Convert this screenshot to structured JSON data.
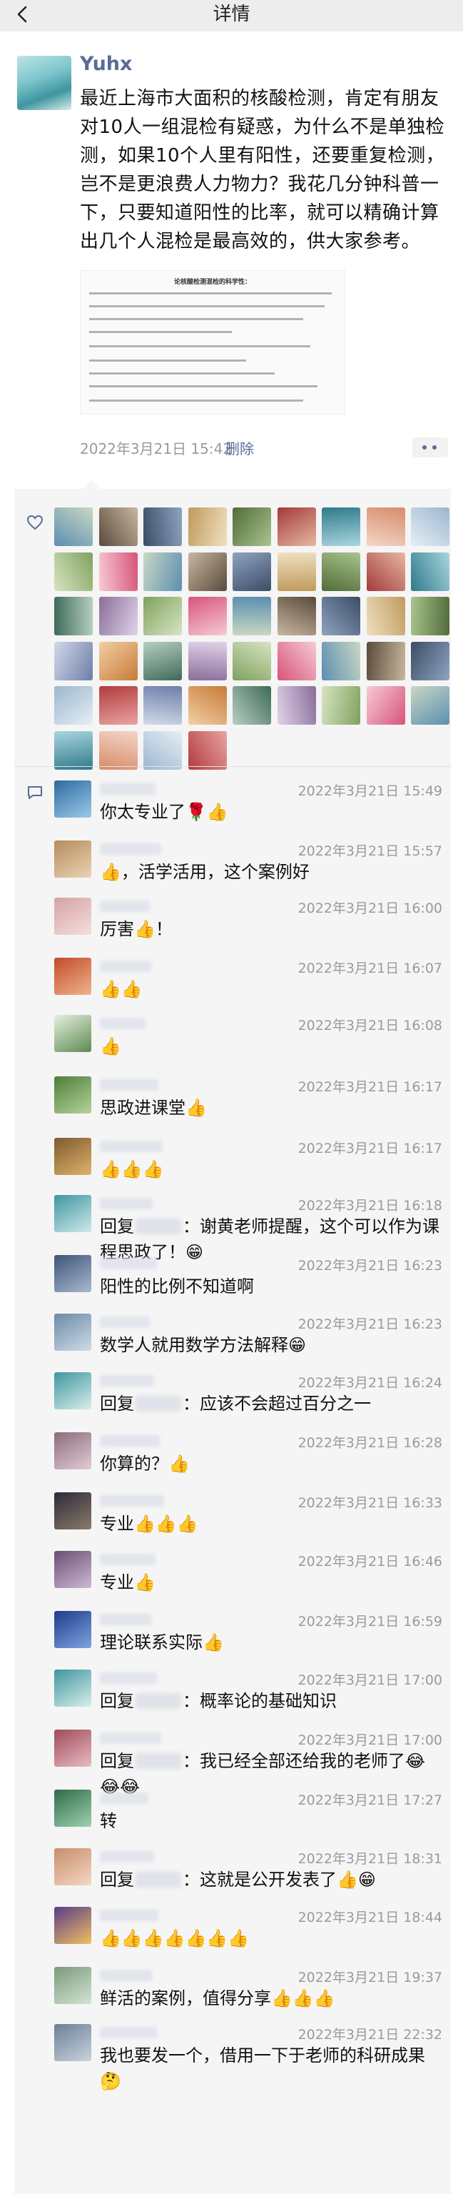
{
  "nav": {
    "title": "详情",
    "back_icon": "chevron-left-icon"
  },
  "post": {
    "author": "Yuhx",
    "text": "最近上海市大面积的核酸检测，肯定有朋友对10人一组混检有疑惑，为什么不是单独检测，如果10个人里有阳性，还要重复检测，岂不是更浪费人力物力？我花几分钟科普一下，只要知道阳性的比率，就可以精确计算出几个人混检是最高效的，供大家参考。",
    "image_title": "论核酸检测混检的科学性：",
    "time": "2022年3月21日 15:42",
    "delete_label": "删除"
  },
  "colors": {
    "link_blue": "#576b95",
    "meta_gray": "#9a9a9a",
    "comment_bg": "#f5f5f5"
  },
  "likes": {
    "icon": "heart-outline-icon",
    "count": 49
  },
  "comments_icon": "comment-bubble-icon",
  "comments": [
    {
      "time": "2022年3月21日 15:49",
      "text": "你太专业了🌹👍"
    },
    {
      "time": "2022年3月21日 15:57",
      "text": "👍，活学活用，这个案例好"
    },
    {
      "time": "2022年3月21日 16:00",
      "text": "厉害👍！"
    },
    {
      "time": "2022年3月21日 16:07",
      "text": "👍👍"
    },
    {
      "time": "2022年3月21日 16:08",
      "text": "👍"
    },
    {
      "time": "2022年3月21日 16:17",
      "text": "思政进课堂👍"
    },
    {
      "time": "2022年3月21日 16:17",
      "text": "👍👍👍"
    },
    {
      "time": "2022年3月21日 16:18",
      "reply_prefix": "回复",
      "text": "：谢黄老师提醒，这个可以作为课程思政了！😁"
    },
    {
      "time": "2022年3月21日 16:23",
      "text": "阳性的比例不知道啊"
    },
    {
      "time": "2022年3月21日 16:23",
      "text": "数学人就用数学方法解释😁"
    },
    {
      "time": "2022年3月21日 16:24",
      "reply_prefix": "回复",
      "text": "：应该不会超过百分之一"
    },
    {
      "time": "2022年3月21日 16:28",
      "text": "你算的？👍"
    },
    {
      "time": "2022年3月21日 16:33",
      "text": "专业👍👍👍"
    },
    {
      "time": "2022年3月21日 16:46",
      "text": "专业👍"
    },
    {
      "time": "2022年3月21日 16:59",
      "text": "理论联系实际👍"
    },
    {
      "time": "2022年3月21日 17:00",
      "reply_prefix": "回复",
      "text": "：概率论的基础知识"
    },
    {
      "time": "2022年3月21日 17:00",
      "reply_prefix": "回复",
      "text": "：我已经全部还给我的老师了😂😂😂"
    },
    {
      "time": "2022年3月21日 17:27",
      "text": "转"
    },
    {
      "time": "2022年3月21日 18:31",
      "reply_prefix": "回复",
      "text": "：这就是公开发表了👍😁"
    },
    {
      "time": "2022年3月21日 18:44",
      "text": "👍👍👍👍👍👍👍"
    },
    {
      "time": "2022年3月21日 19:37",
      "text": "鲜活的案例，值得分享👍👍👍"
    },
    {
      "time": "2022年3月21日 22:32",
      "text": "我也要发一个，借用一下于老师的科研成果🤔"
    }
  ]
}
